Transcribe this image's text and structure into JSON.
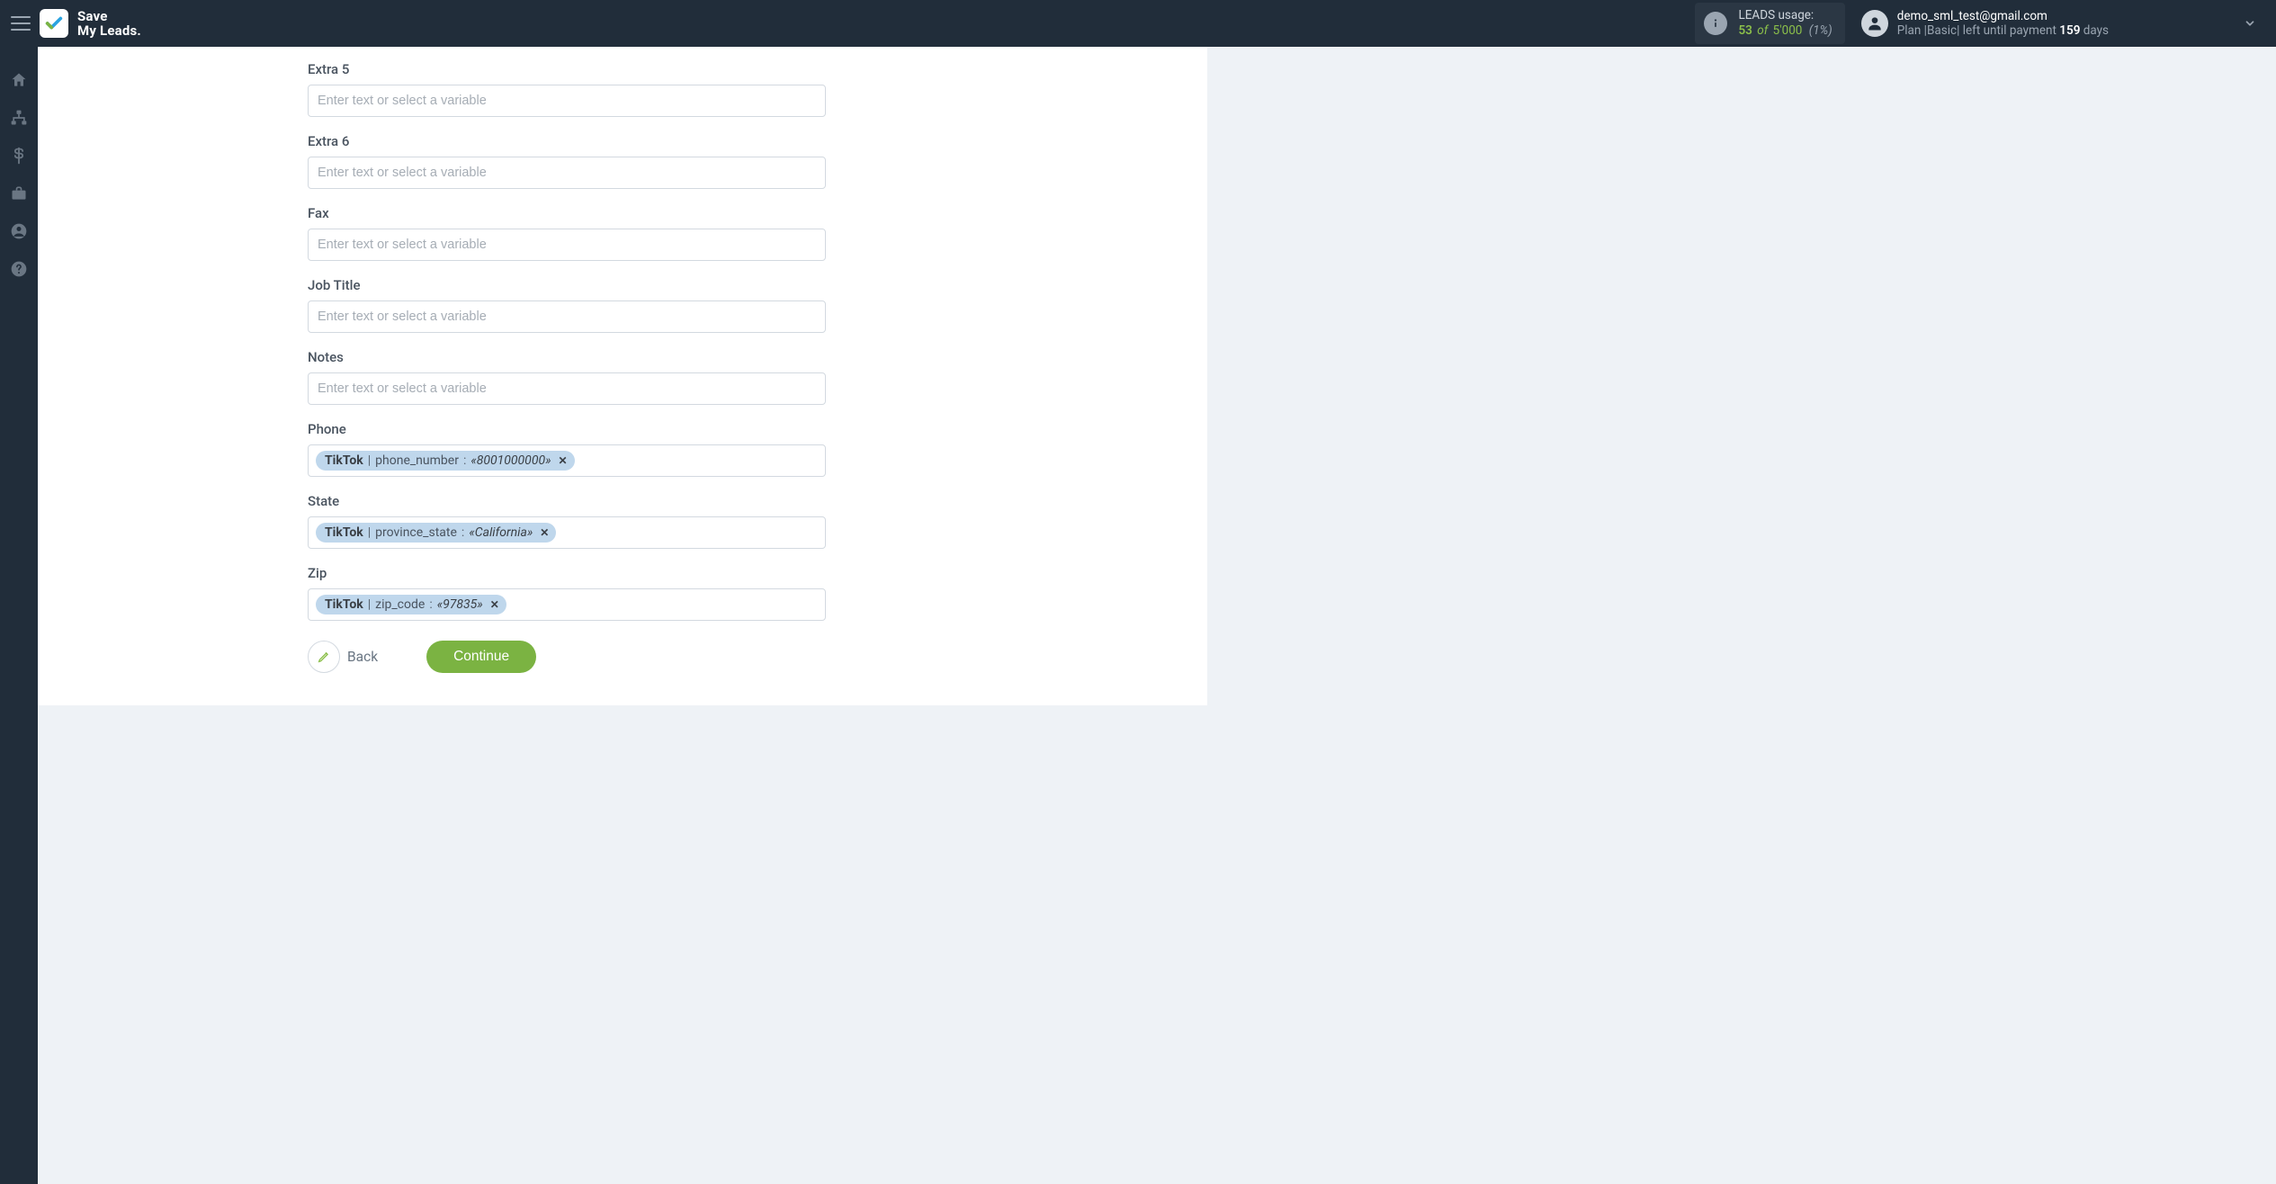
{
  "brand": {
    "line1": "Save",
    "line2": "My Leads."
  },
  "usage": {
    "title": "LEADS usage:",
    "current": "53",
    "of_word": "of",
    "max": "5'000",
    "percent": "(1%)"
  },
  "account": {
    "email": "demo_sml_test@gmail.com",
    "plan_prefix": "Plan |",
    "plan_name": "Basic",
    "plan_mid": "| left until payment",
    "days": "159",
    "days_suffix": "days"
  },
  "placeholders": {
    "variable": "Enter text or select a variable"
  },
  "fields": [
    {
      "key": "extra5",
      "label": "Extra 5",
      "chips": []
    },
    {
      "key": "extra6",
      "label": "Extra 6",
      "chips": []
    },
    {
      "key": "fax",
      "label": "Fax",
      "chips": []
    },
    {
      "key": "jobtitle",
      "label": "Job Title",
      "chips": []
    },
    {
      "key": "notes",
      "label": "Notes",
      "chips": []
    },
    {
      "key": "phone",
      "label": "Phone",
      "chips": [
        {
          "source": "TikTok",
          "field": "phone_number",
          "value": "«8001000000»"
        }
      ]
    },
    {
      "key": "state",
      "label": "State",
      "chips": [
        {
          "source": "TikTok",
          "field": "province_state",
          "value": "«California»"
        }
      ]
    },
    {
      "key": "zip",
      "label": "Zip",
      "chips": [
        {
          "source": "TikTok",
          "field": "zip_code",
          "value": "«97835»"
        }
      ]
    }
  ],
  "buttons": {
    "back": "Back",
    "continue": "Continue"
  },
  "sidebar_icons": [
    "home-icon",
    "sitemap-icon",
    "dollar-icon",
    "briefcase-icon",
    "user-circle-icon",
    "help-icon"
  ]
}
